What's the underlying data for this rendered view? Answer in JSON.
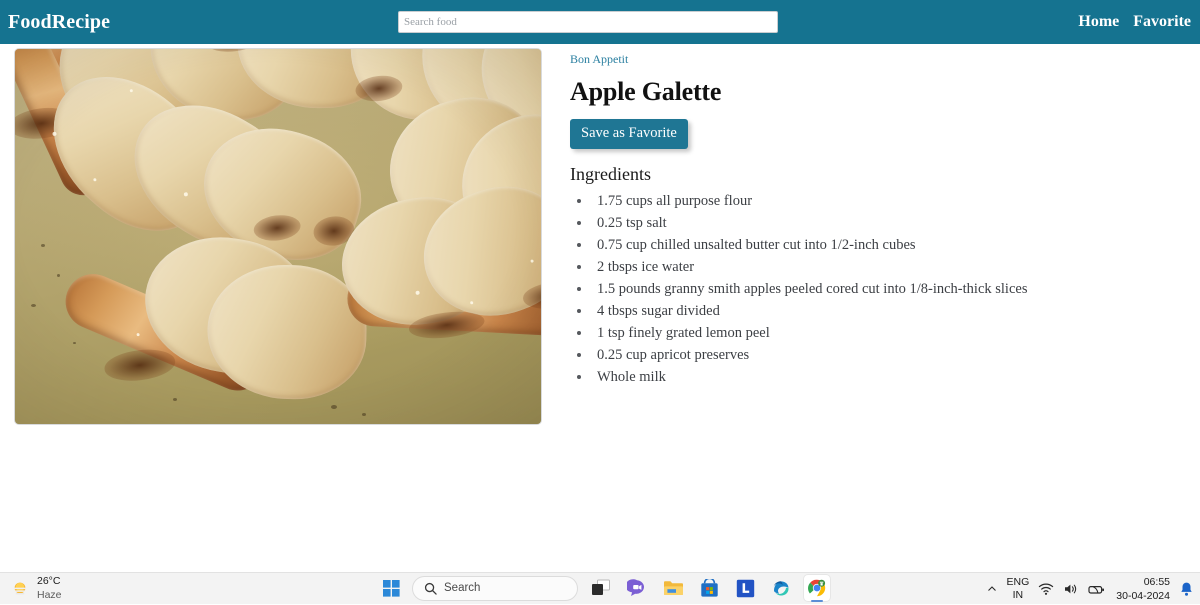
{
  "navbar": {
    "brand": "FoodRecipe",
    "search": {
      "placeholder": "Search food",
      "value": ""
    },
    "links": [
      {
        "label": "Home",
        "name": "nav-link-home"
      },
      {
        "label": "Favorite",
        "name": "nav-link-favorite"
      }
    ],
    "accent_color": "#157390"
  },
  "recipe": {
    "source_label": "Bon Appetit",
    "title": "Apple Galette",
    "favorite_button": "Save as Favorite",
    "ingredients_heading": "Ingredients",
    "ingredients": [
      "1.75 cups all purpose flour",
      "0.25 tsp salt",
      "0.75 cup chilled unsalted butter cut into 1/2-inch cubes",
      "2 tbsps ice water",
      "1.5 pounds granny smith apples peeled cored cut into 1/8-inch-thick slices",
      "4 tbsps sugar divided",
      "1 tsp finely grated lemon peel",
      "0.25 cup apricot preserves",
      "Whole milk"
    ],
    "image_alt": "Apple galette sliced into wedges on parchment",
    "link_color": "#2a7fa0",
    "button_color": "#1f7694"
  },
  "taskbar": {
    "weather": {
      "temperature": "26°C",
      "condition": "Haze",
      "icon": "sun-haze-icon"
    },
    "start": {
      "icon": "windows-start-icon"
    },
    "search": {
      "label": "Search",
      "icon": "search-icon"
    },
    "apps": [
      {
        "name": "task-view-icon",
        "label": "Task View"
      },
      {
        "name": "chat-icon",
        "label": "Chat"
      },
      {
        "name": "file-explorer-icon",
        "label": "File Explorer"
      },
      {
        "name": "microsoft-store-icon",
        "label": "Microsoft Store"
      },
      {
        "name": "lambdatest-icon",
        "label": "L"
      },
      {
        "name": "edge-icon",
        "label": "Microsoft Edge"
      },
      {
        "name": "chrome-icon",
        "label": "Google Chrome"
      }
    ],
    "tray": {
      "chevron": "chevron-up-icon",
      "language_primary": "ENG",
      "language_secondary": "IN",
      "wifi": "wifi-icon",
      "volume": "volume-icon",
      "battery": "battery-icon",
      "time": "06:55",
      "date": "30-04-2024",
      "notification": "bell-icon"
    }
  }
}
